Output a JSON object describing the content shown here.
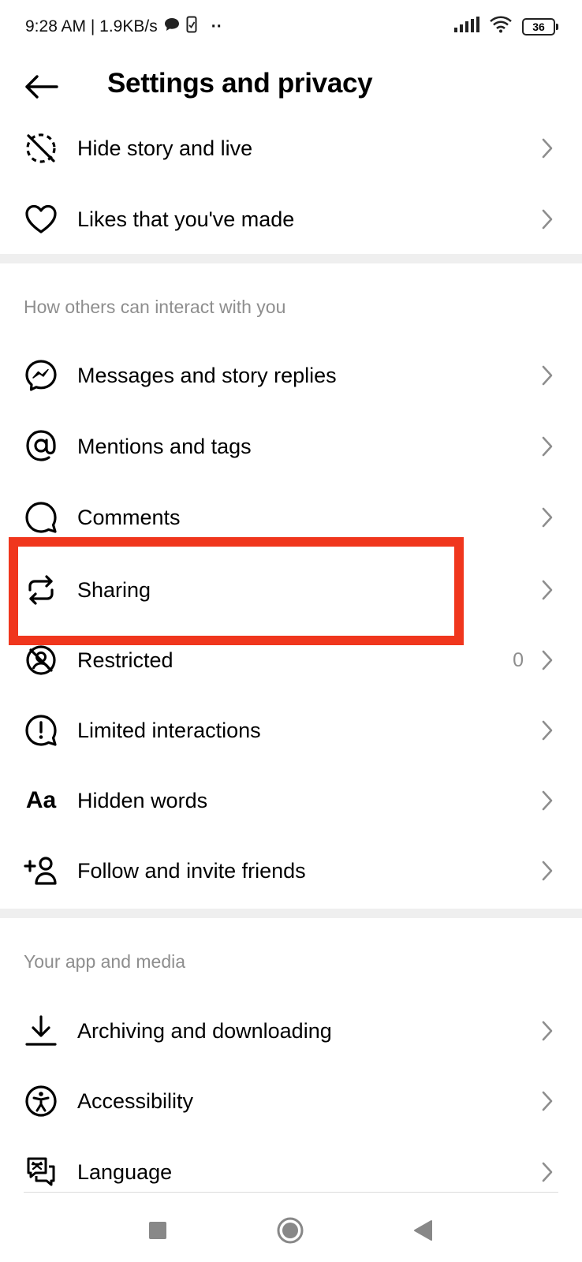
{
  "status_bar": {
    "time_speed": "9:28 AM | 1.9KB/s",
    "extra": "··",
    "battery": "36"
  },
  "header": {
    "title": "Settings and privacy"
  },
  "rows_top": [
    {
      "label": "Hide story and live",
      "icon": "hide-story-icon"
    },
    {
      "label": "Likes that you've made",
      "icon": "heart-icon"
    }
  ],
  "section_interact": {
    "title": "How others can interact with you",
    "items": [
      {
        "label": "Messages and story replies",
        "icon": "messenger-icon"
      },
      {
        "label": "Mentions and tags",
        "icon": "at-sign-icon"
      },
      {
        "label": "Comments",
        "icon": "comment-icon"
      },
      {
        "label": "Sharing",
        "icon": "repost-icon"
      },
      {
        "label": "Restricted",
        "icon": "restricted-icon",
        "count": "0"
      },
      {
        "label": "Limited interactions",
        "icon": "limited-interactions-icon"
      },
      {
        "label": "Hidden words",
        "icon": "hidden-words-icon",
        "glyph": "Aa"
      },
      {
        "label": "Follow and invite friends",
        "icon": "add-friend-icon"
      }
    ]
  },
  "section_app": {
    "title": "Your app and media",
    "items": [
      {
        "label": "Archiving and downloading",
        "icon": "download-icon"
      },
      {
        "label": "Accessibility",
        "icon": "accessibility-icon"
      },
      {
        "label": "Language",
        "icon": "language-icon"
      }
    ]
  },
  "colors": {
    "highlight": "#f0361d",
    "secondary_text": "#8e8e8e",
    "divider": "#efefef"
  }
}
